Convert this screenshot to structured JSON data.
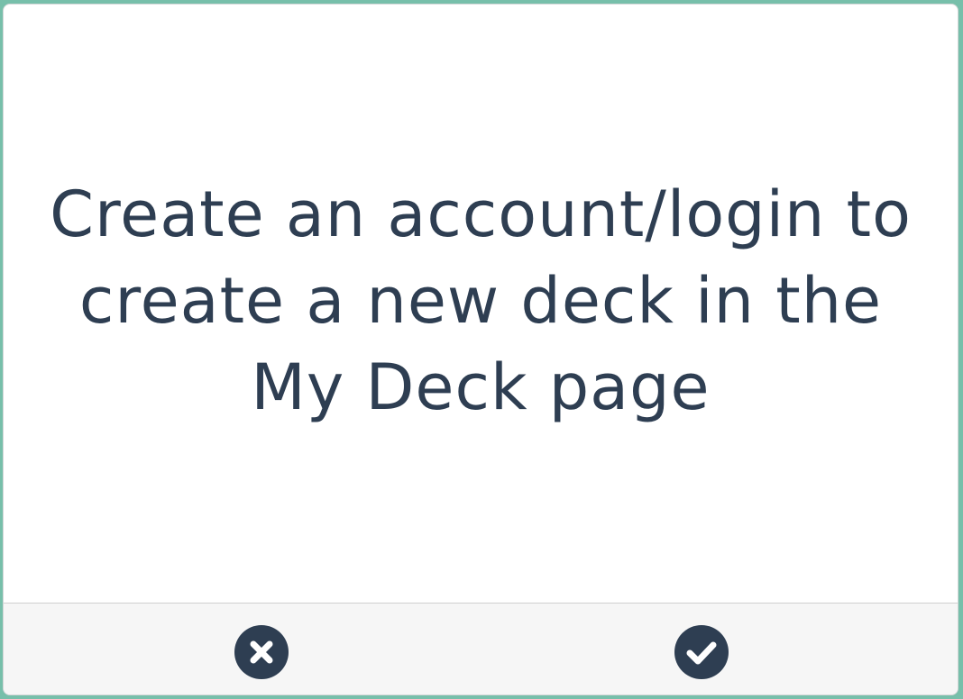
{
  "dialog": {
    "message": "Create an account/login to create a new deck in the My Deck page"
  },
  "footer": {
    "cancel_icon": "close-circle-icon",
    "confirm_icon": "check-circle-icon"
  },
  "colors": {
    "background": "#77bfaa",
    "card": "#ffffff",
    "text": "#2e3e52",
    "footer": "#f6f6f6",
    "icon": "#2e3e52"
  }
}
